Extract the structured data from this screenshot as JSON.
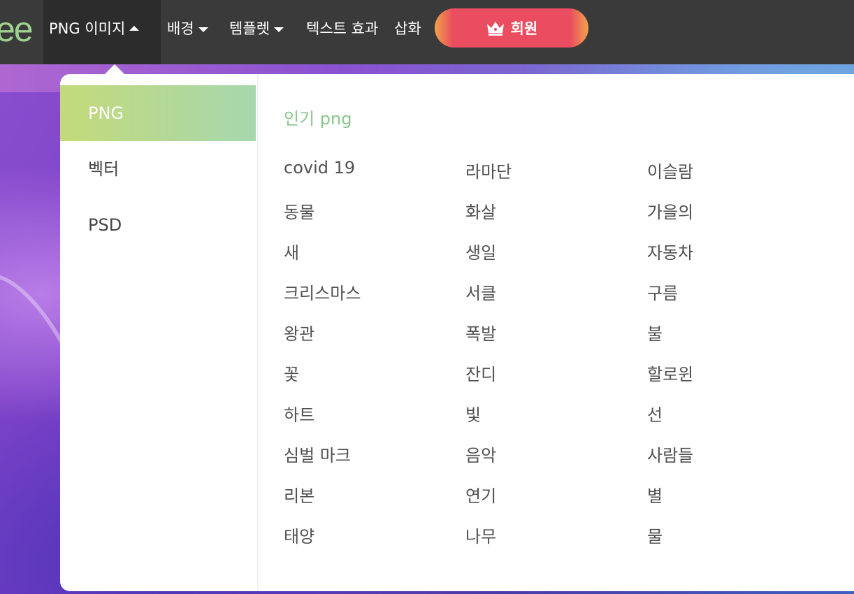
{
  "logo": {
    "text": "ee"
  },
  "nav": {
    "png_images": "PNG 이미지",
    "backgrounds": "배경",
    "templates": "템플렛",
    "text_effects": "텍스트 효과",
    "illustrations": "삽화",
    "member": "회원"
  },
  "dropdown": {
    "sidebar": [
      "PNG",
      "벡터",
      "PSD"
    ],
    "active_sidebar": "PNG",
    "section_title": "인기 png",
    "columns": [
      [
        "covid 19",
        "동물",
        "새",
        "크리스마스",
        "왕관",
        "꽃",
        "하트",
        "심벌 마크",
        "리본",
        "태양"
      ],
      [
        "라마단",
        "화살",
        "생일",
        "서클",
        "폭발",
        "잔디",
        "빛",
        "음악",
        "연기",
        "나무"
      ],
      [
        "이슬람",
        "가을의",
        "자동차",
        "구름",
        "불",
        "할로윈",
        "선",
        "사람들",
        "별",
        "물"
      ]
    ]
  },
  "colors": {
    "topbar": "#3a3a3a",
    "accent_green": "#8ac68e",
    "member_red": "#e94d5f",
    "member_orange": "#f3a24a"
  }
}
